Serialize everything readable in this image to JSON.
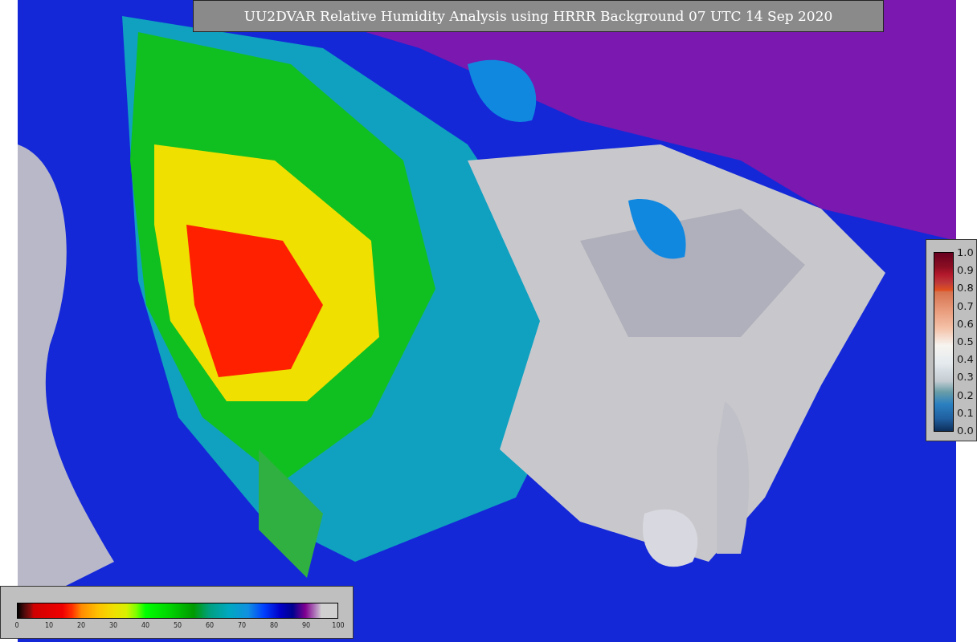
{
  "title": "UU2DVAR Relative Humidity Analysis using HRRR Background 07 UTC 14 Sep 2020",
  "side_colorbar": {
    "ticks": [
      "1.0",
      "0.9",
      "0.8",
      "0.7",
      "0.6",
      "0.5",
      "0.4",
      "0.3",
      "0.2",
      "0.1",
      "0.0"
    ]
  },
  "bottom_colorbar": {
    "ticks": [
      "0",
      "10",
      "20",
      "30",
      "40",
      "50",
      "60",
      "70",
      "80",
      "90",
      "100"
    ]
  }
}
